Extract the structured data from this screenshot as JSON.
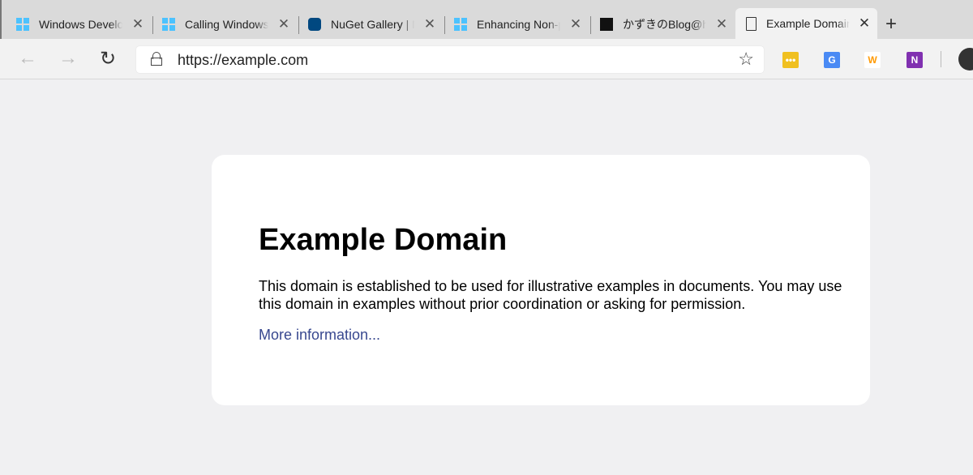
{
  "tabs": [
    {
      "label": "Windows Develo",
      "icon": "windows-icon"
    },
    {
      "label": "Calling Windows",
      "icon": "windows-icon"
    },
    {
      "label": "NuGet Gallery | N",
      "icon": "nuget-icon"
    },
    {
      "label": "Enhancing Non-p",
      "icon": "windows-icon"
    },
    {
      "label": "かずきのBlog@hat",
      "icon": "blog-avatar-icon"
    },
    {
      "label": "Example Domain",
      "icon": "page-icon",
      "active": true
    }
  ],
  "new_tab": "+",
  "address": {
    "url": "https://example.com"
  },
  "extensions": [
    "ellipsis-extension-icon",
    "google-translate-icon",
    "w-extension-icon",
    "onenote-icon"
  ],
  "page": {
    "title": "Example Domain",
    "body": "This domain is established to be used for illustrative examples in documents. You may use this domain in examples without prior coordination or asking for permission.",
    "link": "More information..."
  },
  "colors": {
    "link": "#38488f",
    "page_bg": "#f0f0f2"
  }
}
